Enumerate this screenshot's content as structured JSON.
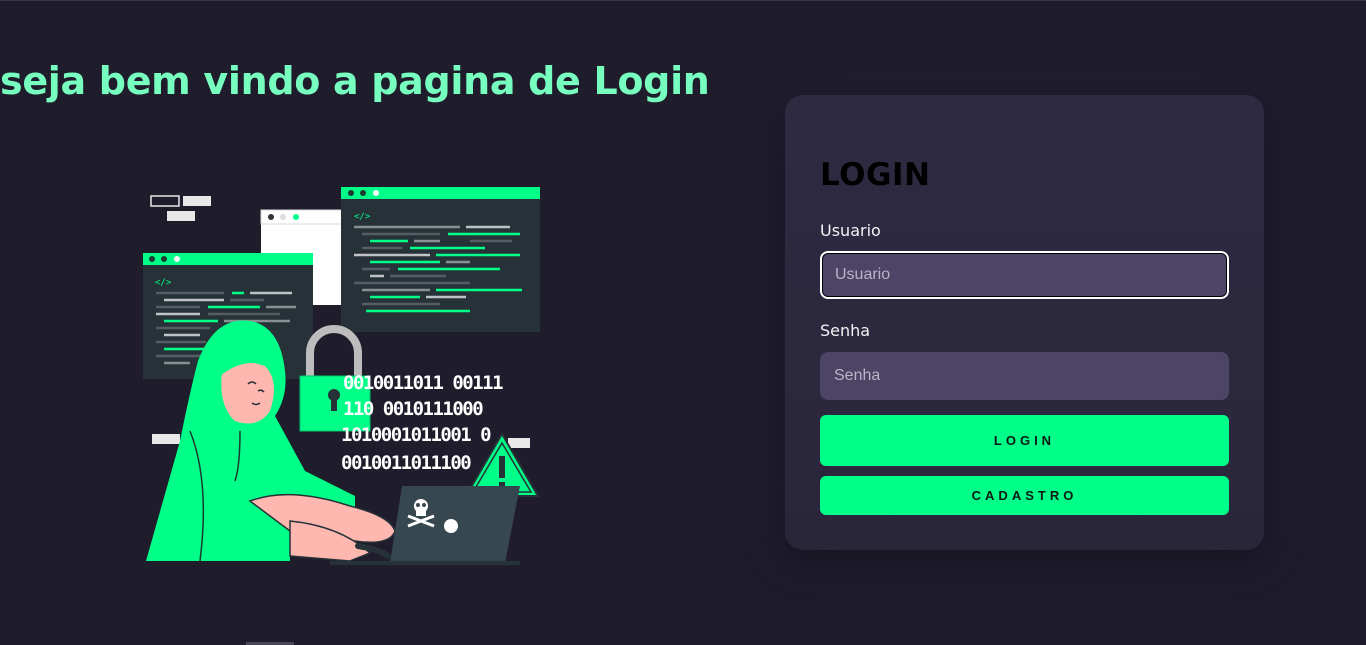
{
  "page": {
    "welcome_text": "seja bem vindo a pagina de Login"
  },
  "illustration": {
    "binary_lines": [
      "0010011011 00111",
      "110 0010111000",
      "1010001011001 0",
      "0010011011100"
    ],
    "accent_color": "#00ff88",
    "icon": "hacker-with-laptop-illustration"
  },
  "login": {
    "title": "LOGIN",
    "username_label": "Usuario",
    "username_placeholder": "Usuario",
    "password_label": "Senha",
    "password_placeholder": "Senha",
    "login_button": "LOGIN",
    "register_button": "CADASTRO"
  },
  "colors": {
    "background": "#1f1c2c",
    "accent": "#00ff88",
    "heading": "#77ffc0",
    "card": "#2e2a42",
    "input": "#4d4566"
  }
}
